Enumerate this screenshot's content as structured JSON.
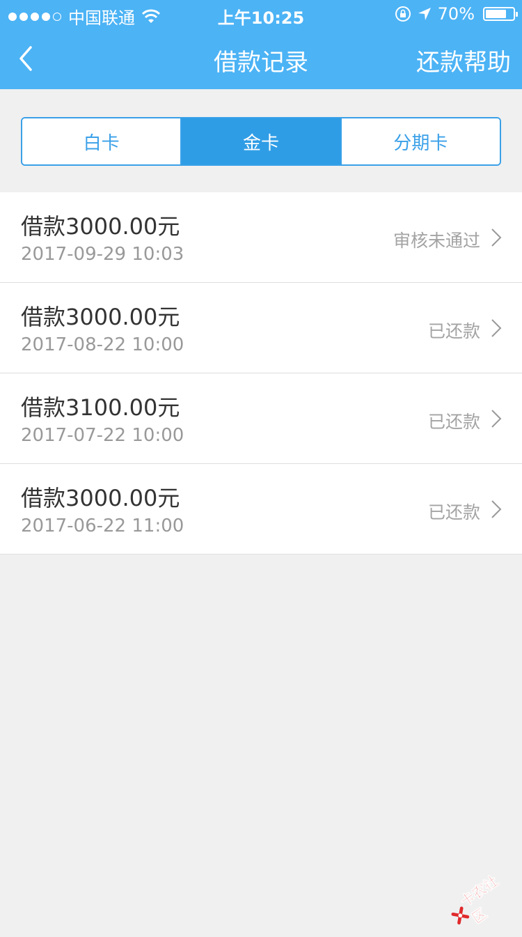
{
  "status_bar": {
    "carrier": "中国联通",
    "time": "上午10:25",
    "battery": "70%"
  },
  "nav": {
    "title": "借款记录",
    "help": "还款帮助"
  },
  "tabs": [
    {
      "label": "白卡",
      "active": false
    },
    {
      "label": "金卡",
      "active": true
    },
    {
      "label": "分期卡",
      "active": false
    }
  ],
  "records": [
    {
      "amount": "借款3000.00元",
      "date": "2017-09-29 10:03",
      "status": "审核未通过"
    },
    {
      "amount": "借款3000.00元",
      "date": "2017-08-22 10:00",
      "status": "已还款"
    },
    {
      "amount": "借款3100.00元",
      "date": "2017-07-22 10:00",
      "status": "已还款"
    },
    {
      "amount": "借款3000.00元",
      "date": "2017-06-22 11:00",
      "status": "已还款"
    }
  ],
  "watermark": "卡农社区",
  "colors": {
    "header": "#4cb3f5",
    "tab_active": "#2f9de6",
    "background": "#f0f0f0"
  }
}
